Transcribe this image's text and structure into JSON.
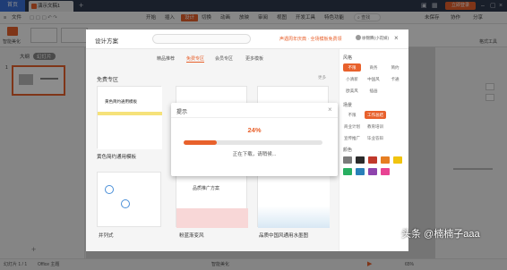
{
  "titlebar": {
    "home_tab": "首页",
    "doc_tab": "演示文稿1",
    "login_button": "立即登录"
  },
  "ribbon": {
    "file_label": "文件",
    "menus": [
      "开始",
      "插入",
      "设计",
      "切换",
      "动画",
      "放映",
      "审阅",
      "视图",
      "开发工具",
      "特色功能"
    ],
    "active_menu": "设计",
    "search_label": "查找",
    "right_items": [
      "未保存",
      "协作",
      "分享"
    ]
  },
  "toolbar": {
    "smart_beautify": "智能美化",
    "format_tools": "格式工具"
  },
  "left_panel": {
    "tab_outline": "大纲",
    "tab_slides": "幻灯片",
    "slide_number": "1"
  },
  "design": {
    "title": "设计方案",
    "promo": "声遇周年庆典 · 全场模板免费领",
    "user": "徐锦腾(小花妍)",
    "tabs": [
      "精品推荐",
      "免费专区",
      "会员专区",
      "更多模板"
    ],
    "active_tab": "免费专区",
    "section": "免费专区",
    "more": "更多",
    "cards": [
      {
        "label": "黄色简约通用模板"
      },
      {
        "label": ""
      },
      {
        "label": ""
      },
      {
        "label": "并列式"
      },
      {
        "label": "粉蓝渐变风"
      },
      {
        "label": "品质中国风通用水墨图"
      }
    ],
    "card_texts": {
      "yellow_title": "黄色简约通用模板",
      "pink_title": "品质推广方案"
    },
    "side": {
      "style_head": "风格",
      "style_pills": [
        "不限",
        "商务",
        "简约",
        "小清新",
        "中国风",
        "卡通",
        "欧美风",
        "插画"
      ],
      "scene_head": "场景",
      "scene_pills": [
        "不限",
        "工作总结",
        "商业计划",
        "教育培训",
        "宣传推广",
        "毕业答辩"
      ],
      "color_head": "颜色",
      "swatches": [
        "#7a7a7a",
        "#2b2b2b",
        "#c0392b",
        "#e67e22",
        "#f1c40f",
        "#27ae60",
        "#2980b9",
        "#8e44ad",
        "#e84393"
      ]
    }
  },
  "prompt": {
    "title": "提示",
    "percent": "24%",
    "progress": 0.24,
    "message": "正在下载，请稍候..."
  },
  "status": {
    "slide_info": "幻灯片 1 / 1",
    "theme": "Office 主题",
    "smart_beautify": "智能美化",
    "zoom": "65%"
  },
  "watermark": "头条 @楠楠子aaa"
}
